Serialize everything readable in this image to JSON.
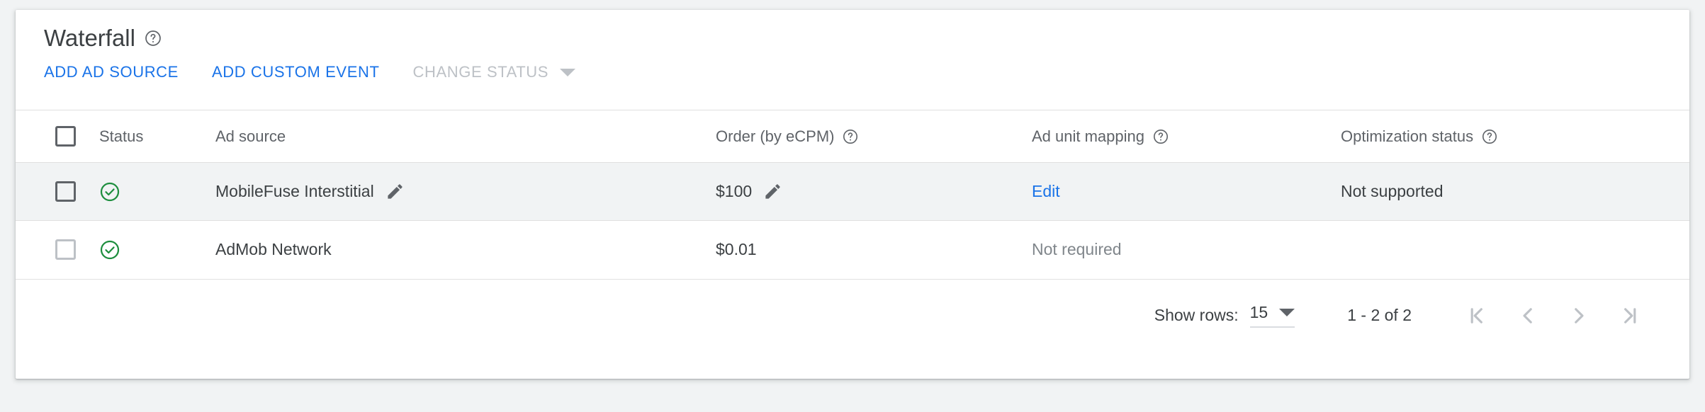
{
  "card": {
    "title": "Waterfall",
    "title_help_icon": "help-outline-icon"
  },
  "toolbar": {
    "add_ad_source_label": "ADD AD SOURCE",
    "add_custom_event_label": "ADD CUSTOM EVENT",
    "change_status_label": "CHANGE STATUS",
    "change_status_disabled": true,
    "dropdown_icon": "caret-down-icon"
  },
  "table": {
    "columns": [
      {
        "key": "select",
        "label": "",
        "help": false
      },
      {
        "key": "status",
        "label": "Status",
        "help": false
      },
      {
        "key": "source",
        "label": "Ad source",
        "help": false
      },
      {
        "key": "order",
        "label": "Order (by eCPM)",
        "help": true
      },
      {
        "key": "mapping",
        "label": "Ad unit mapping",
        "help": true
      },
      {
        "key": "optimization",
        "label": "Optimization status",
        "help": true
      }
    ],
    "rows": [
      {
        "highlighted": true,
        "checkbox_checked": false,
        "status_icon": "check-circle-icon",
        "source": "MobileFuse Interstitial",
        "source_editable": true,
        "order": "$100",
        "order_editable": true,
        "mapping": "Edit",
        "mapping_is_link": true,
        "optimization": "Not supported",
        "optimization_muted": false
      },
      {
        "highlighted": false,
        "checkbox_checked": false,
        "status_icon": "check-circle-icon",
        "source": "AdMob Network",
        "source_editable": false,
        "order": "$0.01",
        "order_editable": false,
        "mapping": "Not required",
        "mapping_is_link": false,
        "optimization": "",
        "optimization_muted": false
      }
    ]
  },
  "footer": {
    "show_rows_label": "Show rows:",
    "rows_per_page": "15",
    "range_text": "1 - 2 of 2",
    "pager": [
      {
        "name": "first-page",
        "icon": "first-page-icon"
      },
      {
        "name": "previous-page",
        "icon": "chevron-left-icon"
      },
      {
        "name": "next-page",
        "icon": "chevron-right-icon"
      },
      {
        "name": "last-page",
        "icon": "last-page-icon"
      }
    ]
  },
  "colors": {
    "accent_blue": "#1a73e8",
    "status_green": "#1e8e3e",
    "disabled_grey": "#bdc1c6",
    "text_primary": "#3c4043",
    "text_secondary": "#5f6368",
    "row_highlight": "#f1f3f4",
    "page_background": "#f1f3f4"
  }
}
